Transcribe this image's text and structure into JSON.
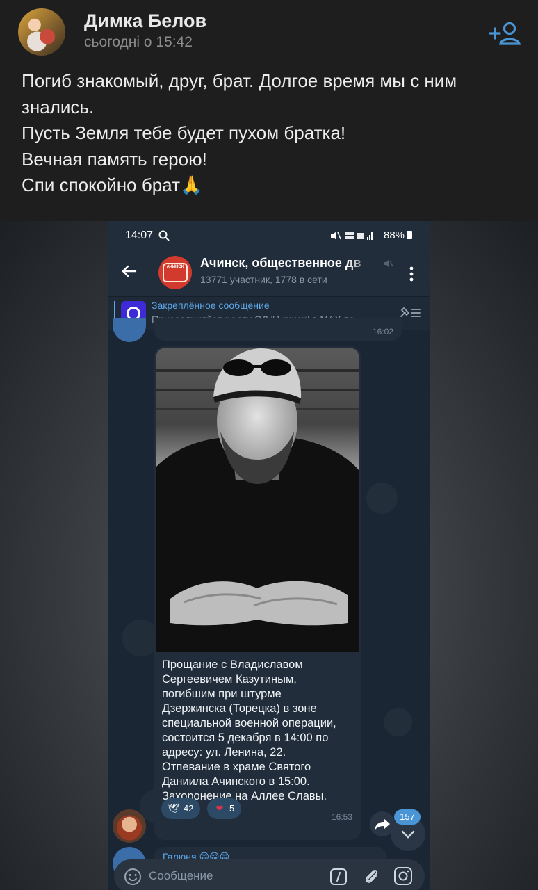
{
  "post": {
    "author_name": "Димка Белов",
    "time": "сьогодні о 15:42",
    "text_lines": [
      "Погиб знакомый, друг, брат. Долгое время мы с ним",
      "знались.",
      "Пусть Земля тебе будет пухом братка!",
      "Вечная память герою!",
      "Спи спокойно брат🙏"
    ]
  },
  "phone": {
    "status": {
      "time": "14:07",
      "battery": "88%"
    },
    "chat": {
      "title": "Ачинск, общественное дв",
      "subtitle": "13771 участник, 1778 в сети",
      "avatar_text": "АЧИНСК"
    },
    "pinned": {
      "title": "Закреплённое сообщение",
      "text": "Присоединяйся к чату ОД \"Ачинск\" в MAX по..."
    },
    "previous_message": {
      "time": "16:02"
    },
    "message": {
      "text_lines": [
        "Прощание с Владиславом",
        "Сергеевичем Казутиным,",
        "погибшим при штурме",
        "Дзержинска (Торецка) в зоне",
        "специальной военной операции,",
        "состоится 5 декабря в 14:00 по",
        "адресу: ул. Ленина, 22.",
        "Отпевание в храме Святого",
        "Даниила Ачинского в 15:00.",
        "Захоронение на Аллее Славы."
      ],
      "reactions": [
        {
          "emoji": "🕊",
          "count": "42"
        },
        {
          "emoji": "❤",
          "count": "5"
        }
      ],
      "time": "16:53"
    },
    "next_message": {
      "sender": "Галюня 😁😁😁"
    },
    "unread_count": "157",
    "input": {
      "placeholder": "Сообщение"
    }
  },
  "colors": {
    "accent": "#5fa8e8",
    "badge": "#4a95d6",
    "heart": "#e0334a"
  }
}
